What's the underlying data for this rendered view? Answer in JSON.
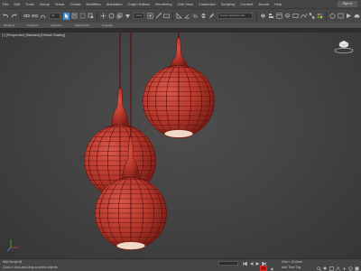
{
  "menu": {
    "items": [
      "File",
      "Edit",
      "Tools",
      "Group",
      "Views",
      "Create",
      "Modifiers",
      "Animation",
      "Graph Editors",
      "Rendering",
      "Civil View",
      "Customize",
      "Scripting",
      "Content",
      "Arnold",
      "Help"
    ],
    "signin_label": "Sign In"
  },
  "toolbar": {
    "selection_filter": "All",
    "named_selection_placeholder": "Create Selection Set",
    "view_label": "View"
  },
  "ribbon": {
    "tabs": [
      "Modeling",
      "Freeform",
      "Selection",
      "Object Paint",
      "Populate"
    ]
  },
  "viewport": {
    "label": "[+] [Perspective] [Standard] [Default Shading]"
  },
  "lamps": {
    "body_color": "#c0392b",
    "wire_color": "#5a1010",
    "count": 3
  },
  "status": {
    "script_listener": "MAXScript Mi",
    "prompt": "Click or click-and-drag to select objects",
    "grid": "Grid = 10,0mm",
    "time_tag": "Add Time Tag"
  },
  "colors": {
    "menu_bg": "#444444",
    "toolbar_bg": "#474747",
    "viewport_bg": "#444444",
    "accent_blue": "#3f8fd8",
    "key_red": "#aa1111"
  }
}
